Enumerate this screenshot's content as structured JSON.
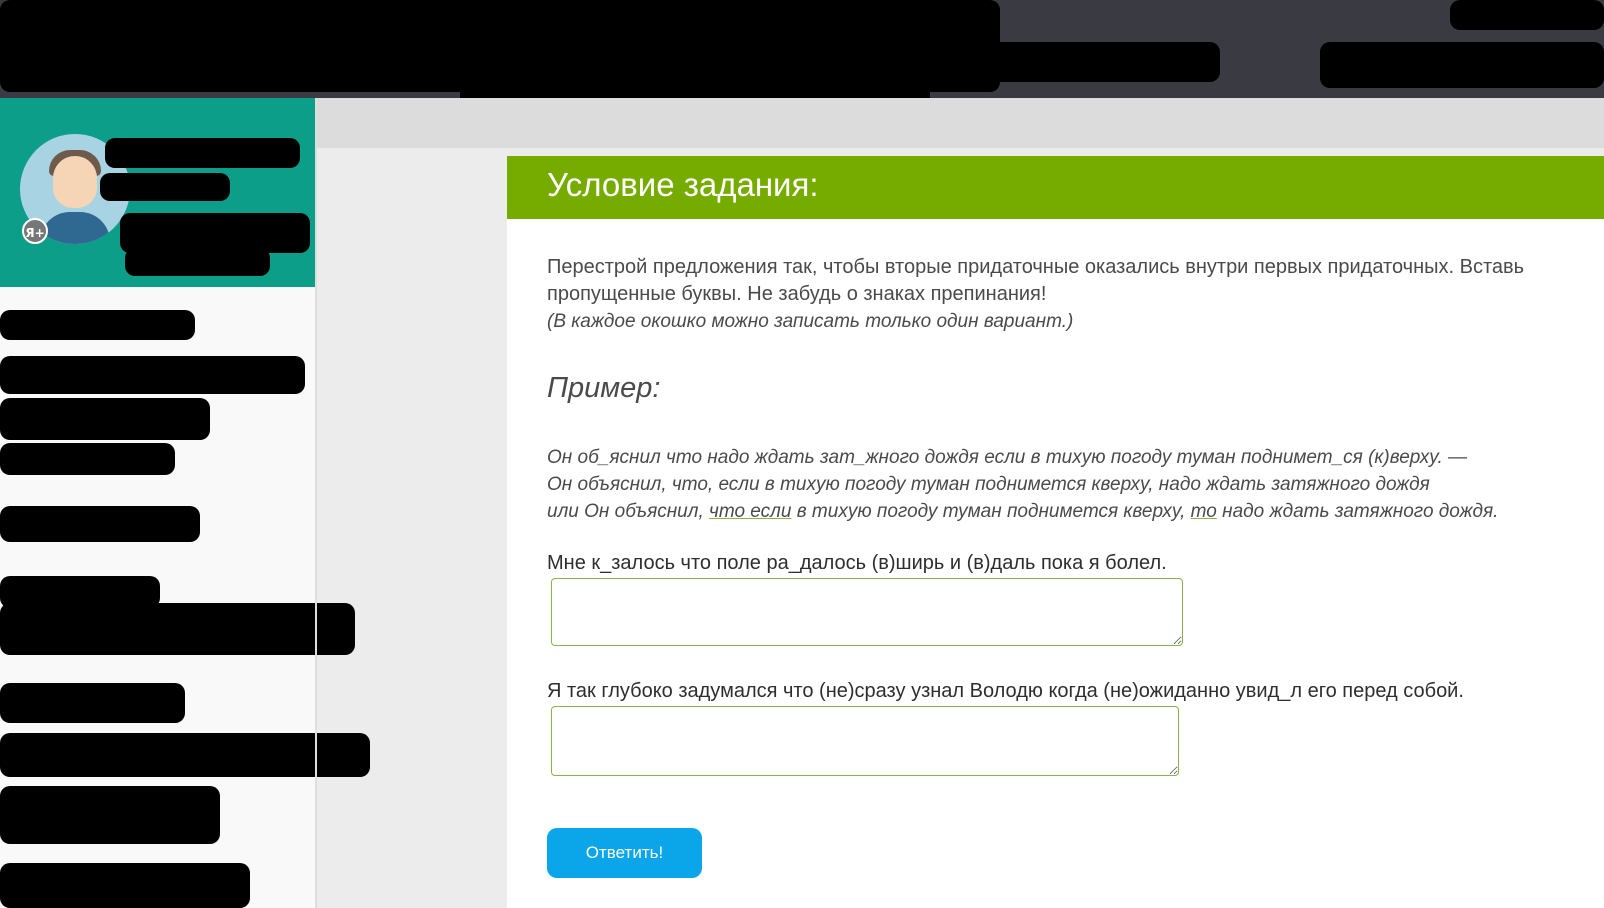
{
  "header": {
    "title": "Условие задания:"
  },
  "task": {
    "instruction": "Перестрой предложения так, чтобы вторые придаточные оказались внутри первых придаточных. Вставь пропущенные буквы. Не забудь о знаках препинания!",
    "note": "(В каждое окошко можно записать только один вариант.)"
  },
  "example": {
    "heading": "Пример:",
    "line1": "Он об_яснил что надо ждать зат_жного дождя если в тихую погоду туман поднимет_ся (к)верху. —",
    "line2": "Он объяснил, что, если в тихую погоду туман поднимется кверху, надо ждать затяжного дождя",
    "line3_a": "или Он объяснил, ",
    "line3_b": "что если",
    "line3_c": " в тихую погоду туман поднимется кверху, ",
    "line3_d": "то",
    "line3_e": " надо ждать затяжного дождя."
  },
  "questions": [
    {
      "text": "Мне к_залось что поле ра_далось (в)ширь и (в)даль пока я болел.",
      "value": ""
    },
    {
      "text": "Я так глубоко задумался что (не)сразу узнал Володю когда (не)ожиданно увид_л его перед собой.",
      "value": ""
    }
  ],
  "submit_label": "Ответить!",
  "profile": {
    "badge": "Я+"
  },
  "icons": {
    "avatar": "user-avatar-icon",
    "badge": "user-badge-icon"
  }
}
